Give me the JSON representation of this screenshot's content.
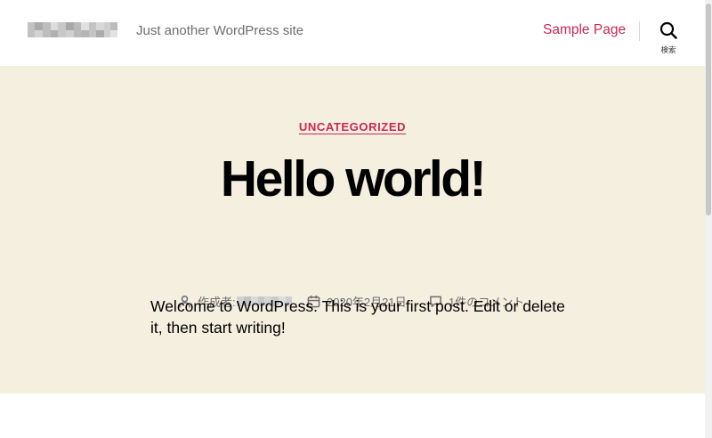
{
  "header": {
    "site_description": "Just another WordPress site",
    "nav": [
      {
        "label": "Sample Page"
      }
    ],
    "search_label": "検索"
  },
  "post": {
    "category": "UNCATEGORIZED",
    "title": "Hello world!",
    "meta": {
      "author_prefix": "作成者:",
      "date": "2020年2月21日",
      "comments": "1件のコメント"
    },
    "content": "Welcome to WordPress. This is your first post. Edit or delete it, then start writing!"
  },
  "colors": {
    "accent": "#cd2653",
    "hero_background": "#f5efe0",
    "secondary_text": "#6d6d6d",
    "page_background": "#ffffff"
  },
  "icons": [
    "search-icon",
    "person-icon",
    "calendar-icon",
    "comment-icon"
  ]
}
